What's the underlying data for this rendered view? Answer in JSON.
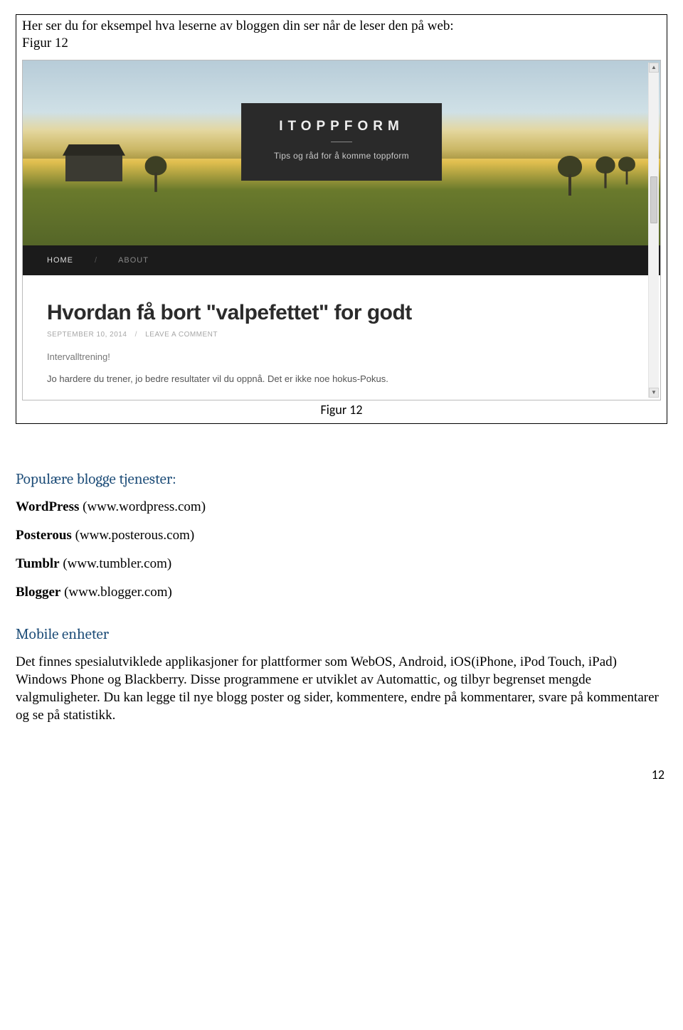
{
  "intro": {
    "text": "Her ser du for eksempel hva leserne av bloggen din ser når de leser den på web:",
    "fig_label": "Figur 12"
  },
  "screenshot": {
    "hero_title": "ITOPPFORM",
    "hero_subtitle": "Tips og råd for å komme toppform",
    "nav": {
      "home": "HOME",
      "about": "ABOUT"
    },
    "post": {
      "title": "Hvordan få bort \"valpefettet\" for godt",
      "date": "SEPTEMBER 10, 2014",
      "comment_link": "LEAVE A COMMENT",
      "line1": "Intervalltrening!",
      "line2": "Jo hardere du trener, jo bedre resultater vil du oppnå. Det er ikke noe hokus-Pokus."
    },
    "scroll_up": "▲",
    "scroll_down": "▼"
  },
  "fig_caption": "Figur 12",
  "popular": {
    "heading": "Populære blogge tjenester:",
    "services": [
      {
        "name": "WordPress",
        "url": "(www.wordpress.com)"
      },
      {
        "name": "Posterous",
        "url": "(www.posterous.com)"
      },
      {
        "name": "Tumblr",
        "url": "(www.tumbler.com)"
      },
      {
        "name": "Blogger",
        "url": "(www.blogger.com)"
      }
    ]
  },
  "mobile": {
    "heading": "Mobile enheter",
    "paragraph": "Det finnes spesialutviklede applikasjoner for plattformer som WebOS, Android, iOS(iPhone, iPod Touch, iPad) Windows Phone og Blackberry. Disse programmene er utviklet av Automattic, og tilbyr begrenset mengde valgmuligheter. Du kan legge til nye blogg poster og sider, kommentere, endre på kommentarer, svare på kommentarer og se på statistikk."
  },
  "page_number": "12"
}
